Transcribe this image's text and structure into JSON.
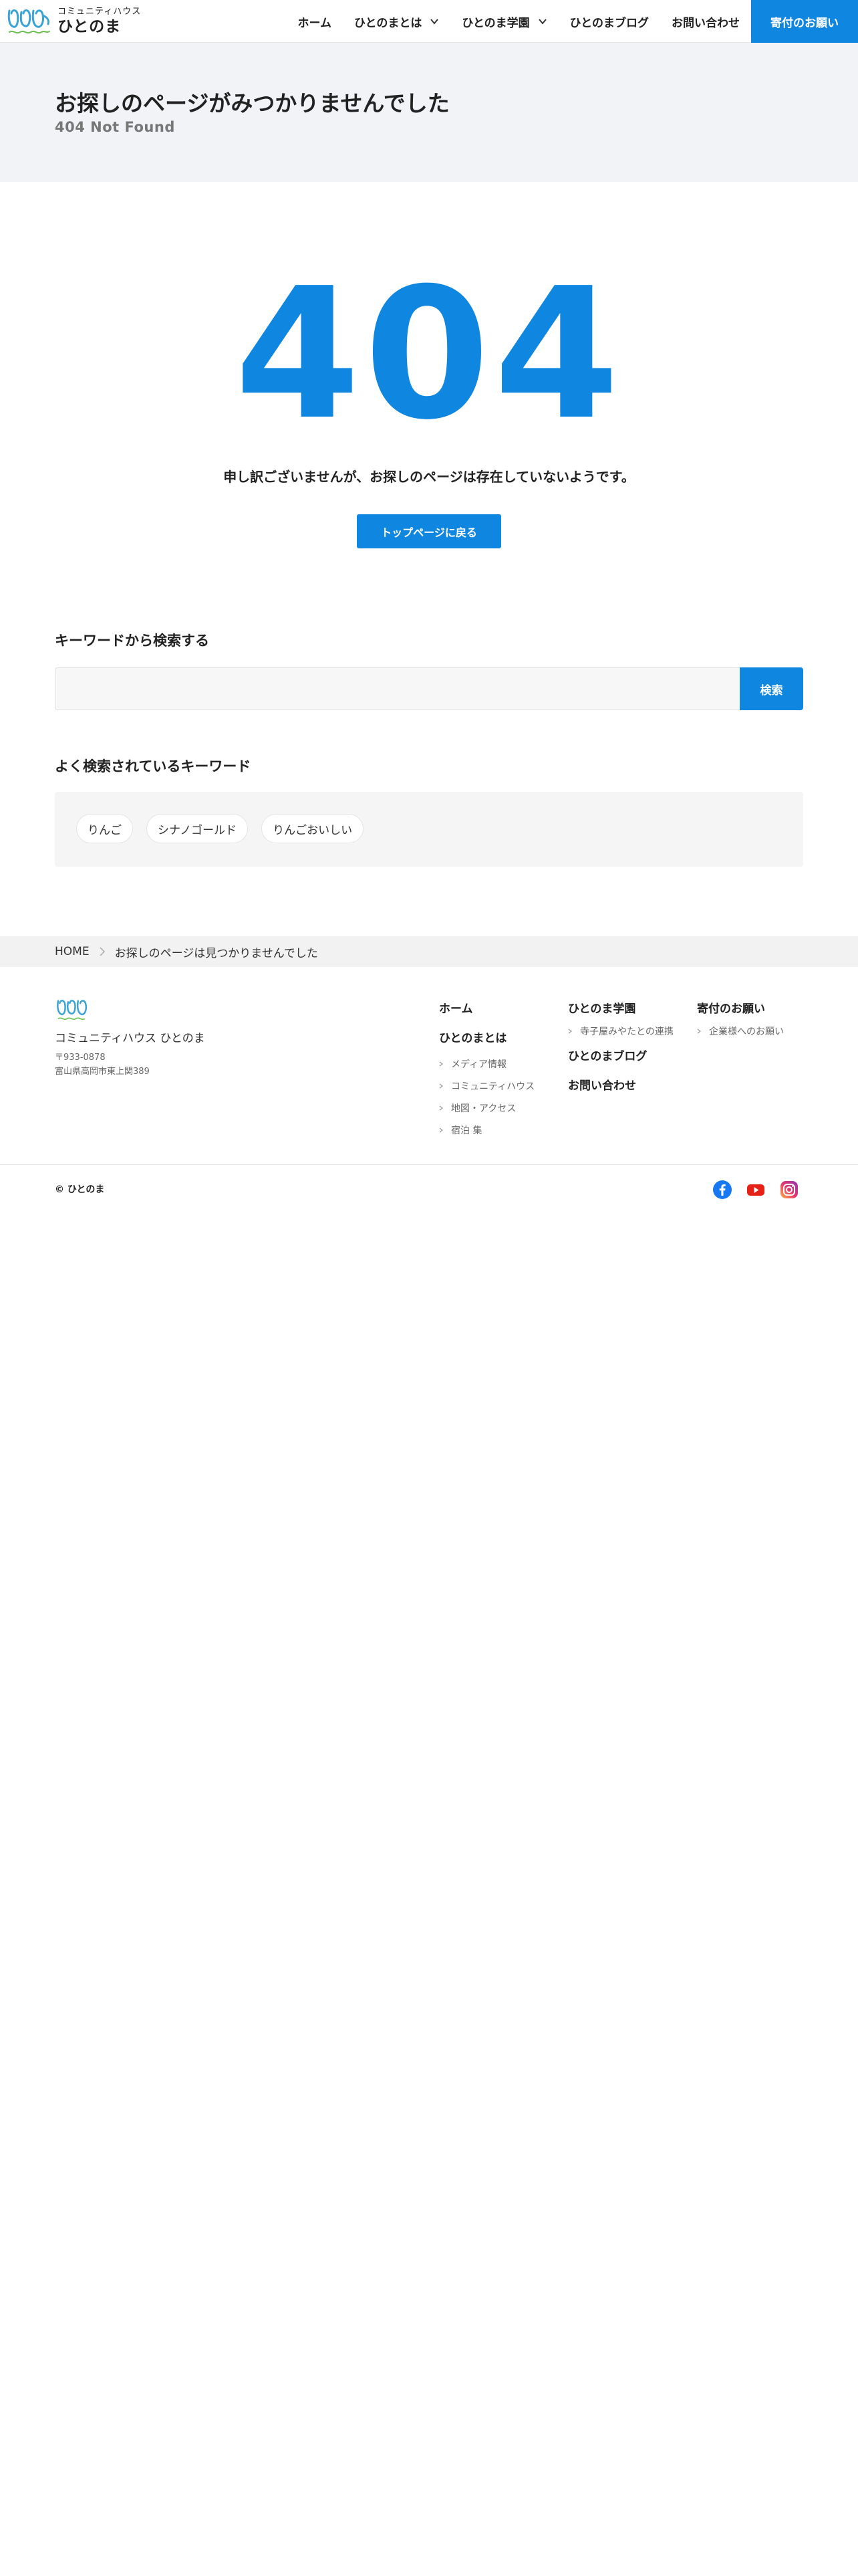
{
  "header": {
    "logo_sub": "コミュニティハウス",
    "logo_main": "ひとのま",
    "nav": [
      {
        "label": "ホーム",
        "dropdown": false
      },
      {
        "label": "ひとのまとは",
        "dropdown": true
      },
      {
        "label": "ひとのま学園",
        "dropdown": true
      },
      {
        "label": "ひとのまブログ",
        "dropdown": false
      },
      {
        "label": "お問い合わせ",
        "dropdown": false
      }
    ],
    "donate_label": "寄付のお願い"
  },
  "title_band": {
    "title": "お探しのページがみつかりませんでした",
    "subtitle": "404 Not Found"
  },
  "error": {
    "code": "404",
    "message": "申し訳ございませんが、お探しのページは存在していないようです。",
    "top_button": "トップページに戻る"
  },
  "search": {
    "heading": "キーワードから検索する",
    "placeholder": "",
    "button": "検索"
  },
  "popular": {
    "heading": "よく検索されているキーワード",
    "keywords": [
      "りんご",
      "シナノゴールド",
      "りんごおいしい"
    ]
  },
  "breadcrumb": {
    "home": "HOME",
    "current": "お探しのページは見つかりませんでした"
  },
  "footer": {
    "name": "コミュニティハウス ひとのま",
    "postal": "〒933-0878",
    "address": "富山県高岡市東上関389",
    "col1": {
      "home": "ホーム",
      "about": "ひとのまとは",
      "about_items": [
        "メディア情報",
        "コミュニティハウス",
        "地図・アクセス",
        "宿泊 集"
      ]
    },
    "col2": {
      "school": "ひとのま学園",
      "school_items": [
        "寺子屋みやたとの連携"
      ],
      "blog": "ひとのまブログ",
      "contact": "お問い合わせ"
    },
    "col3": {
      "donate": "寄付のお願い",
      "donate_items": [
        "企業様へのお願い"
      ]
    },
    "copyright": "© ひとのま",
    "social": [
      "facebook-icon",
      "youtube-icon",
      "instagram-icon"
    ]
  },
  "colors": {
    "accent": "#0f86e0",
    "band_bg": "#f2f3f7",
    "panel_bg": "#f5f5f5",
    "facebook": "#1877f2",
    "youtube": "#e62117"
  }
}
